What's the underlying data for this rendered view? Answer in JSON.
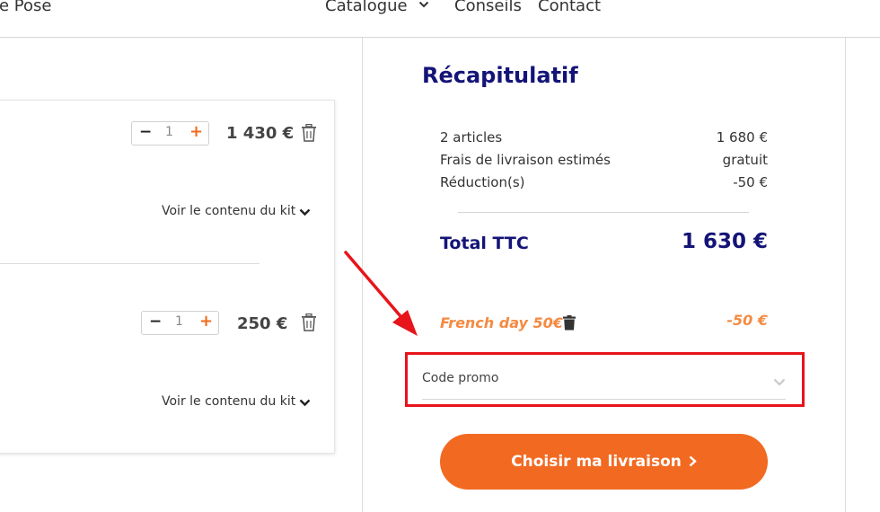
{
  "nav": {
    "items": [
      {
        "label": "re Pose"
      },
      {
        "label": "Catalogue"
      },
      {
        "label": "Conseils"
      },
      {
        "label": "Contact"
      }
    ]
  },
  "cart": {
    "items": [
      {
        "quantity": "1",
        "price": "1 430 €",
        "kit_link": "Voir le contenu du kit"
      },
      {
        "quantity": "1",
        "price": "250 €",
        "kit_link": "Voir le contenu du kit"
      }
    ],
    "stepper": {
      "minus": "−",
      "plus": "+"
    }
  },
  "summary": {
    "title": "Récapitulatif",
    "rows": [
      {
        "label": "2 articles",
        "value": "1 680 €"
      },
      {
        "label": "Frais de livraison estimés",
        "value": "gratuit"
      },
      {
        "label": "Réduction(s)",
        "value": "-50 €"
      }
    ],
    "total_label": "Total TTC",
    "total_value": "1 630 €",
    "promo_applied": {
      "name": "French day 50€",
      "amount": "-50 €"
    },
    "promo_field": {
      "placeholder": "Code promo"
    },
    "cta_label": "Choisir ma livraison"
  },
  "colors": {
    "brand_navy": "#141478",
    "brand_orange": "#f26a22",
    "promo_orange": "#f58a42",
    "highlight_red": "#e8141b"
  }
}
